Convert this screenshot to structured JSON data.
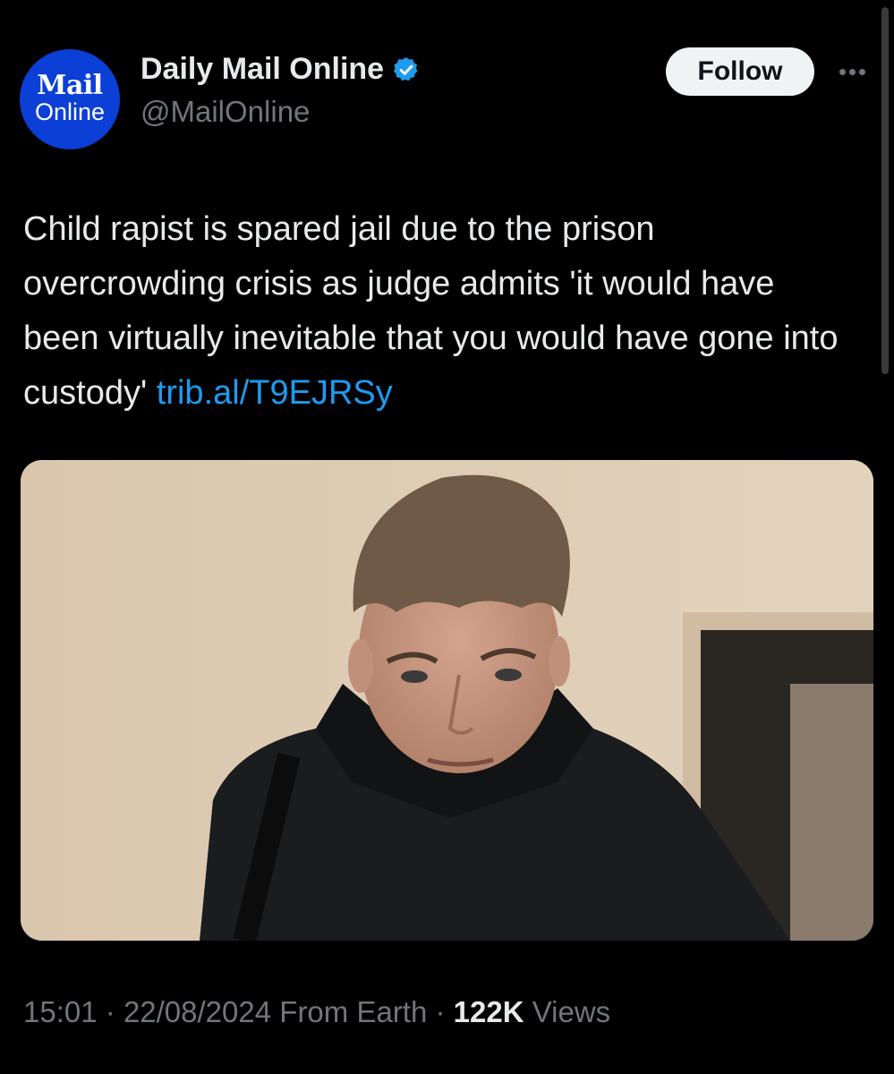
{
  "author": {
    "avatar_top": "Mail",
    "avatar_bottom": "Online",
    "display_name": "Daily Mail Online",
    "handle": "@MailOnline",
    "verified": true
  },
  "actions": {
    "follow_label": "Follow",
    "more_icon": "more-horizontal-icon"
  },
  "tweet": {
    "text": "Child rapist is spared jail due to the prison overcrowding crisis as judge admits 'it would have been virtually inevitable that you would have gone into custody'",
    "link": "trib.al/T9EJRSy"
  },
  "meta": {
    "time": "15:01",
    "date": "22/08/2024",
    "location": "From Earth",
    "separator": "·",
    "views_count": "122K",
    "views_label": "Views"
  },
  "colors": {
    "background": "#000000",
    "text": "#e7e9ea",
    "secondary": "#71767b",
    "link": "#1d9bf0",
    "brand": "#0b3fd6"
  }
}
